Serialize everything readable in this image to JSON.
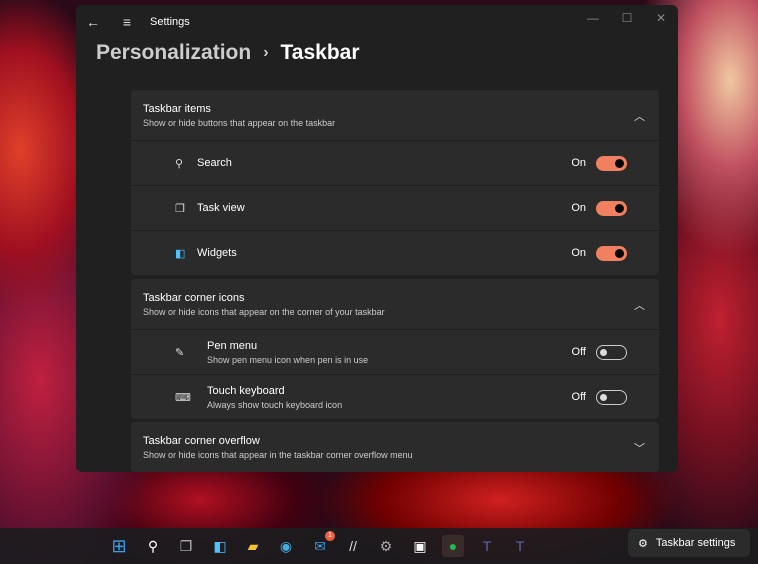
{
  "window": {
    "title": "Settings",
    "breadcrumb_parent": "Personalization",
    "breadcrumb_sep": "›",
    "breadcrumb_current": "Taskbar"
  },
  "sections": [
    {
      "title": "Taskbar items",
      "desc": "Show or hide buttons that appear on the taskbar",
      "items": [
        {
          "label": "Search",
          "state": "On"
        },
        {
          "label": "Task view",
          "state": "On"
        },
        {
          "label": "Widgets",
          "state": "On"
        }
      ]
    },
    {
      "title": "Taskbar corner icons",
      "desc": "Show or hide icons that appear on the corner of your taskbar",
      "items": [
        {
          "label": "Pen menu",
          "desc": "Show pen menu icon when pen is in use",
          "state": "Off"
        },
        {
          "label": "Touch keyboard",
          "desc": "Always show touch keyboard icon",
          "state": "Off"
        }
      ]
    },
    {
      "title": "Taskbar corner overflow",
      "desc": "Show or hide icons that appear in the taskbar corner overflow menu"
    }
  ],
  "taskbar": {
    "mail_badge": "1",
    "tooltip": "Taskbar settings"
  }
}
